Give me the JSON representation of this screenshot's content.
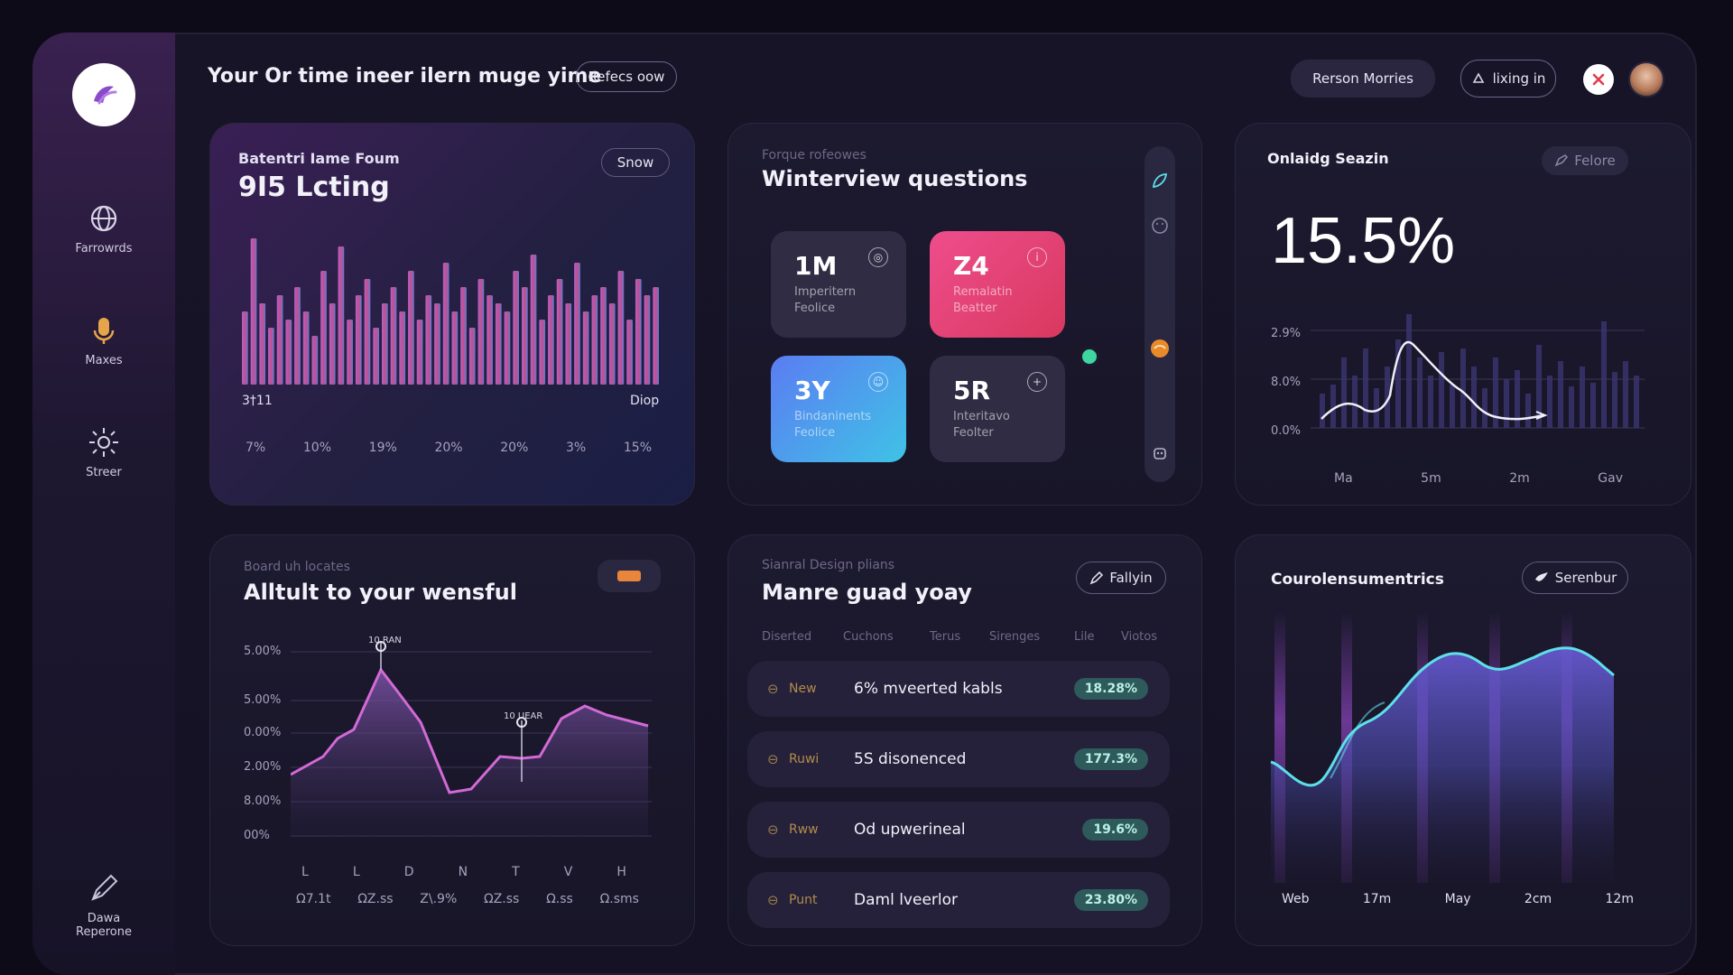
{
  "header": {
    "title": "Your Or time ineer ilern muge yime",
    "refresh_label": "Refecs oow",
    "person_label": "Rerson Morries",
    "login_label": "lixing in"
  },
  "sidebar": {
    "items": [
      {
        "label": "Farrowrds",
        "icon": "globe-icon"
      },
      {
        "label": "Maxes",
        "icon": "microphone-icon"
      },
      {
        "label": "Streer",
        "icon": "sun-icon"
      }
    ],
    "bottom": {
      "label_line1": "Dawa",
      "label_line2": "Reperone",
      "icon": "pen-icon"
    }
  },
  "card1": {
    "subtitle": "Batentri Iame Foum",
    "value": "9I5 Lcting",
    "button": "Snow",
    "left_label": "3†11",
    "right_label": "Diop",
    "x_ticks": [
      "7%",
      "10%",
      "19%",
      "20%",
      "20%",
      "3%",
      "15%"
    ],
    "bars": [
      0.45,
      0.9,
      0.5,
      0.35,
      0.55,
      0.4,
      0.6,
      0.45,
      0.3,
      0.7,
      0.5,
      0.85,
      0.4,
      0.55,
      0.65,
      0.35,
      0.5,
      0.6,
      0.45,
      0.7,
      0.4,
      0.55,
      0.5,
      0.75,
      0.45,
      0.6,
      0.35,
      0.65,
      0.55,
      0.5,
      0.45,
      0.7,
      0.6,
      0.8,
      0.4,
      0.55,
      0.65,
      0.5,
      0.75,
      0.45,
      0.55,
      0.6,
      0.5,
      0.7,
      0.4,
      0.65,
      0.55,
      0.6
    ]
  },
  "card2": {
    "eyebrow": "Forque rofeowes",
    "title": "Winterview questions",
    "tiles": [
      {
        "value": "1M",
        "sub1": "Imperitern",
        "sub2": "Feolice",
        "icon": "camera-icon"
      },
      {
        "value": "Z4",
        "sub1": "Remalatin",
        "sub2": "Beatter",
        "icon": "info-icon"
      },
      {
        "value": "3Y",
        "sub1": "Bindaninents",
        "sub2": "Feolice",
        "icon": "user-icon"
      },
      {
        "value": "5R",
        "sub1": "Interitavo",
        "sub2": "Feolter",
        "icon": "plus-icon"
      }
    ],
    "rail_icons": [
      "leaf-icon",
      "face-icon",
      "orange-orb-icon",
      "robot-icon"
    ]
  },
  "card3": {
    "title": "Onlaidg Seazin",
    "button": "Felore",
    "value": "15.5%",
    "y_ticks": [
      "2.9%",
      "8.0%",
      "0.0%"
    ],
    "x_ticks": [
      "Ma",
      "5m",
      "2m",
      "Gav"
    ]
  },
  "card4": {
    "eyebrow": "Board uh locates",
    "title": "Alltult to your wensful",
    "y_ticks": [
      "5.00%",
      "5.00%",
      "0.00%",
      "2.00%",
      "8.00%",
      "00%"
    ],
    "x_ticks_top": [
      "L",
      "L",
      "D",
      "N",
      "T",
      "V",
      "H"
    ],
    "x_ticks_bottom": [
      "Ω7.1t",
      "ΩZ.ss",
      "Z\\.9%",
      "ΩZ.ss",
      "Ω.ss",
      "Ω.sms"
    ],
    "annotation1": "10 RAN",
    "annotation2": "10 UEAR"
  },
  "card5": {
    "eyebrow": "Sianral Design plians",
    "title": "Manre guad yoay",
    "button": "Fallyin",
    "columns": [
      "Diserted",
      "Cuchons",
      "Terus",
      "Sirenges",
      "Lile",
      "Viotos"
    ],
    "rows": [
      {
        "status": "New",
        "name": "6% mveerted kabls",
        "badge": "18.28%"
      },
      {
        "status": "Ruwi",
        "name": "5S disonenced",
        "badge": "177.3%"
      },
      {
        "status": "Rww",
        "name": "Od upwerineal",
        "badge": "19.6%"
      },
      {
        "status": "Punt",
        "name": "Daml lveerlor",
        "badge": "23.80%"
      }
    ]
  },
  "card6": {
    "title": "Courolensumentrics",
    "button": "Serenbur",
    "x_ticks": [
      "Web",
      "17m",
      "May",
      "2cm",
      "12m"
    ]
  },
  "colors": {
    "accent_pink": "#e7468a",
    "accent_blue": "#4a8cf0",
    "accent_cyan": "#5ee0e8",
    "accent_purple": "#b36be6",
    "close_red": "#e53a4e"
  }
}
